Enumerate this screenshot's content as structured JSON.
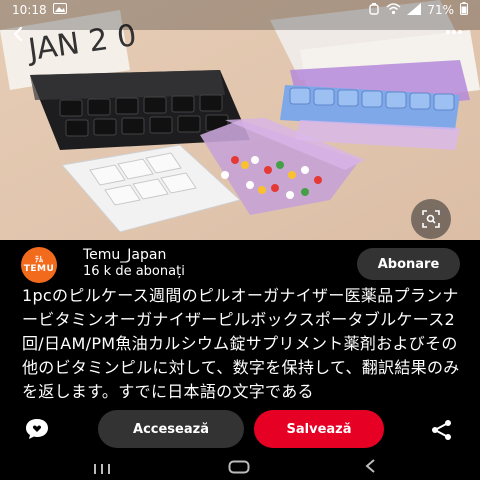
{
  "status": {
    "time": "10:18",
    "battery": "71%"
  },
  "creator": {
    "avatar_top": "ﾃﾑ",
    "avatar_bottom": "TEMU",
    "name": "Temu_Japan",
    "followers": "16 k de abonați",
    "follow_label": "Abonare"
  },
  "description": "1pcのピルケース週間のピルオーガナイザー医薬品プランナービタミンオーガナイザーピルボックスポータブルケース2回/日AM/PM魚油カルシウム錠サプリメント薬剤およびその他のビタミンピルに対して、数字を保持して、翻訳結果のみを返します。すでに日本語の文字である",
  "actions": {
    "visit_label": "Accesează",
    "save_label": "Salvează"
  },
  "colors": {
    "save": "#e60023",
    "pill_button": "#333333",
    "avatar": "#f26b1d"
  },
  "icons": {
    "back": "chevron-left-icon",
    "more": "more-dots-icon",
    "lens": "visual-search-icon",
    "comment": "comment-heart-icon",
    "share": "share-icon"
  }
}
